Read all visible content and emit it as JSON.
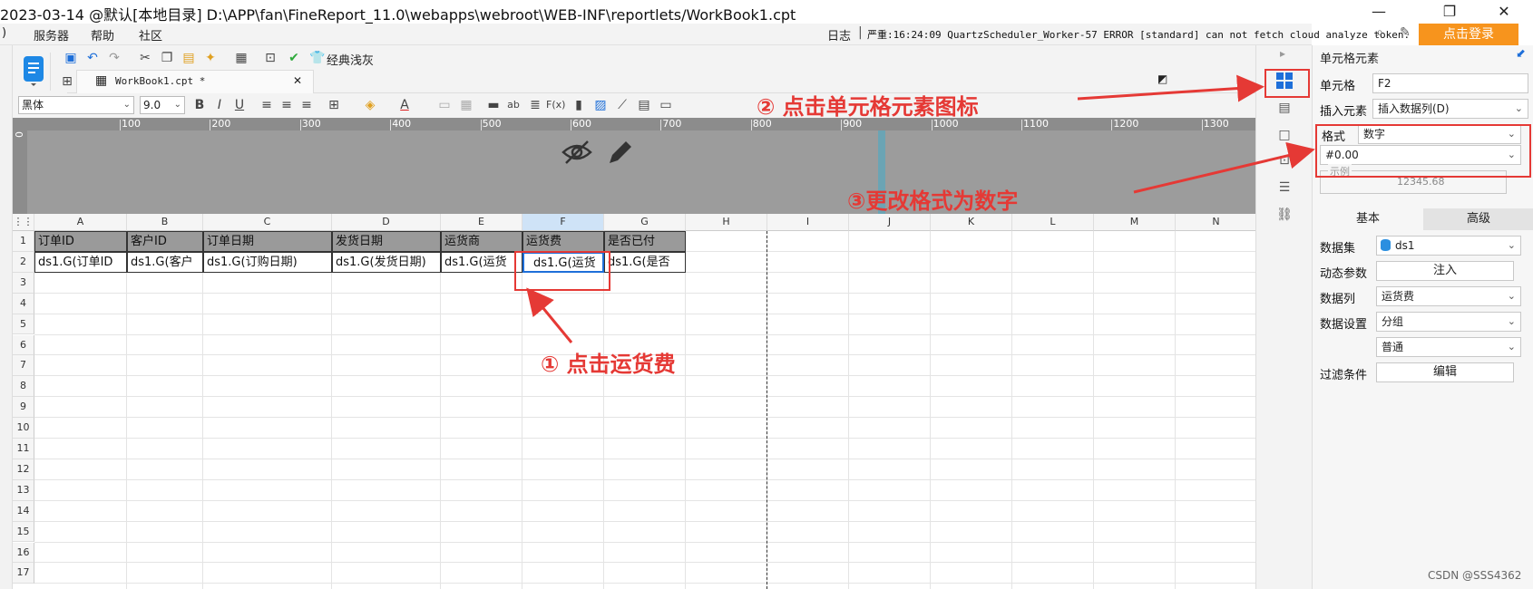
{
  "window": {
    "title": "2023-03-14 @默认[本地目录]    D:\\APP\\fan\\FineReport_11.0\\webapps\\webroot\\WEB-INF\\reportlets/WorkBook1.cpt",
    "minimize": "—",
    "restore": "❐",
    "close": "✕"
  },
  "menu": {
    "items": [
      ")",
      "服务器",
      "帮助",
      "社区"
    ],
    "log_label": "日志",
    "log_text": "严重:16:24:09 QuartzScheduler_Worker-57 ERROR [standard] can not fetch cloud analyze token.",
    "login_button": "点击登录"
  },
  "toolbar": {
    "theme_label": "经典浅灰",
    "tab_label": "WorkBook1.cpt *",
    "tab_close": "✕"
  },
  "format_bar": {
    "font_family": "黑体",
    "font_size": "9.0",
    "bold": "B",
    "italic": "I",
    "underline": "U",
    "font_color_glyph": "A",
    "text_glyph": "ab",
    "fx_glyph": "F(x)"
  },
  "ruler": {
    "ticks": [
      "100",
      "200",
      "300",
      "400",
      "500",
      "600",
      "700",
      "800",
      "900",
      "1000",
      "1100",
      "1200",
      "1300"
    ],
    "vertical_tick": "0"
  },
  "sheet": {
    "columns": [
      "A",
      "B",
      "C",
      "D",
      "E",
      "F",
      "G",
      "H",
      "I",
      "J",
      "K",
      "L",
      "M",
      "N"
    ],
    "rows": [
      "1",
      "2",
      "3",
      "4",
      "5",
      "6",
      "7",
      "8",
      "9",
      "10",
      "11",
      "12",
      "13",
      "14",
      "15",
      "16",
      "17"
    ],
    "header_cells": [
      "订单ID",
      "客户ID",
      "订单日期",
      "发货日期",
      "运货商",
      "运货费",
      "是否已付"
    ],
    "data_cells": [
      "ds1.G(订单ID",
      "ds1.G(客户",
      "ds1.G(订购日期)",
      "ds1.G(发货日期)",
      "ds1.G(运货",
      "ds1.G(运货",
      "ds1.G(是否"
    ]
  },
  "annotations": {
    "step1": "① 点击运货费",
    "step2": "② 点击单元格元素图标",
    "step3": "③更改格式为数字"
  },
  "panel": {
    "title": "单元格元素",
    "cell_label": "单元格",
    "cell_value": "F2",
    "insert_label": "插入元素",
    "insert_value": "插入数据列(D)",
    "format_label": "格式",
    "format_value": "数字",
    "format_pattern": "#0.00",
    "example_legend": "示例",
    "example_value": "12345.68",
    "tab_basic": "基本",
    "tab_advanced": "高级",
    "dataset_label": "数据集",
    "dataset_value": "ds1",
    "dynamic_param_label": "动态参数",
    "inject_button": "注入",
    "datacol_label": "数据列",
    "datacol_value": "运货费",
    "datasetting_label": "数据设置",
    "datasetting_value": "分组",
    "datasetting_sub": "普通",
    "filter_label": "过滤条件",
    "edit_button": "编辑"
  },
  "watermark": "CSDN @SSS4362",
  "colors": {
    "accent_orange": "#f7941d",
    "annotation_red": "#e53935",
    "header_gray": "#9a9a9a",
    "selected_blue": "#1e6fd9"
  }
}
